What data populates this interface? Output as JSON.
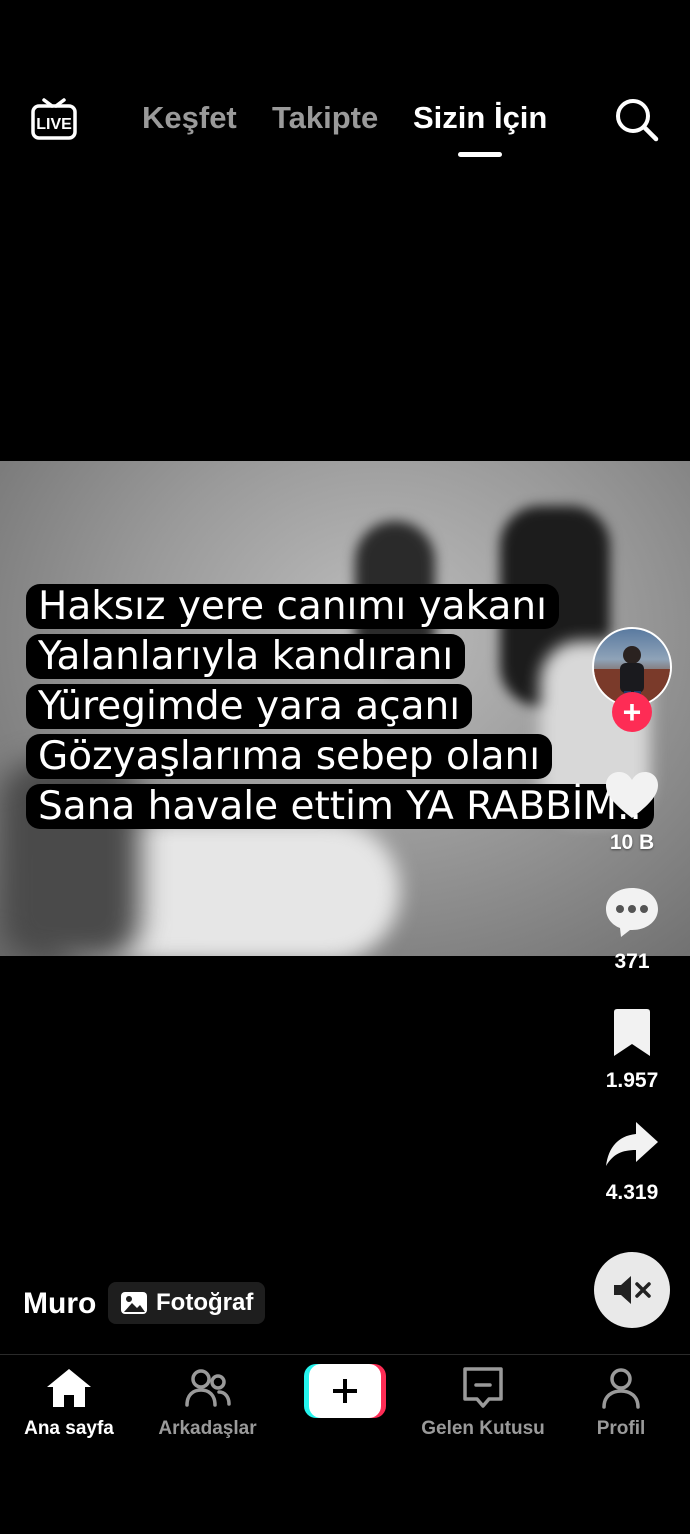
{
  "top_bar": {
    "live_label": "LIVE",
    "tabs": [
      {
        "label": "Keşfet"
      },
      {
        "label": "Takipte"
      },
      {
        "label": "Sizin İçin"
      }
    ]
  },
  "post": {
    "caption_lines": [
      "Haksız yere canımı yakanı",
      "Yalanlarıyla kandıranı",
      "Yüregimde yara açanı",
      "Gözyaşlarıma sebep olanı",
      "Sana havale ettim YA RABBİM.."
    ],
    "author": "Muro",
    "type_badge": "Fotoğraf"
  },
  "actions": {
    "likes": "10 B",
    "comments": "371",
    "saves": "1.957",
    "shares": "4.319"
  },
  "nav": {
    "home": "Ana sayfa",
    "friends": "Arkadaşlar",
    "inbox": "Gelen Kutusu",
    "profile": "Profil"
  },
  "colors": {
    "background": "#000000",
    "accent_red": "#fe2c55",
    "accent_cyan": "#25f4ee",
    "inactive_text": "#9a9a9a"
  },
  "icons": [
    "live-icon",
    "search-icon",
    "heart-icon",
    "comment-icon",
    "bookmark-icon",
    "share-icon",
    "mute-icon",
    "photo-icon",
    "home-icon",
    "friends-icon",
    "plus-icon",
    "inbox-icon",
    "profile-icon"
  ]
}
